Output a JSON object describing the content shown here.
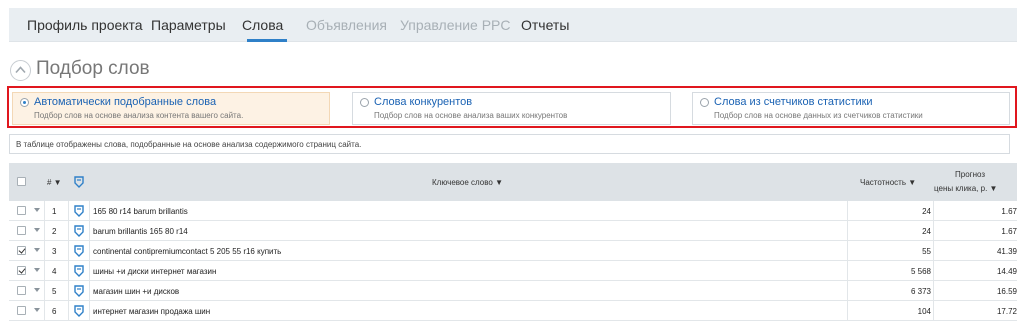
{
  "tabs": [
    {
      "label": "Профиль проекта",
      "state": "normal"
    },
    {
      "label": "Параметры",
      "state": "normal"
    },
    {
      "label": "Слова",
      "state": "active"
    },
    {
      "label": "Объявления",
      "state": "disabled"
    },
    {
      "label": "Управление PPC",
      "state": "disabled"
    },
    {
      "label": "Отчеты",
      "state": "normal"
    }
  ],
  "page": {
    "title": "Подбор слов"
  },
  "options": [
    {
      "title": "Автоматически подобранные слова",
      "desc": "Подбор слов на основе анализа контента вашего сайта.",
      "selected": true
    },
    {
      "title": "Слова конкурентов",
      "desc": "Подбор слов на основе анализа ваших конкурентов",
      "selected": false
    },
    {
      "title": "Слова из счетчиков статистики",
      "desc": "Подбор слов на основе данных из счетчиков статистики",
      "selected": false
    }
  ],
  "info": "В таблице отображены слова, подобранные на основе анализа содержимого страниц сайта.",
  "table": {
    "headers": {
      "num": "#",
      "keyword": "Ключевое слово",
      "frequency": "Частотность",
      "forecast_line1": "Прогноз",
      "forecast_line2": "цены клика, р."
    },
    "rows": [
      {
        "num": "1",
        "keyword": "165 80 r14 barum brillantis",
        "frequency": "24",
        "price": "1.67",
        "checked": false
      },
      {
        "num": "2",
        "keyword": "barum brillantis 165 80 r14",
        "frequency": "24",
        "price": "1.67",
        "checked": false
      },
      {
        "num": "3",
        "keyword": "continental contipremiumcontact 5 205 55 r16 купить",
        "frequency": "55",
        "price": "41.39",
        "checked": true
      },
      {
        "num": "4",
        "keyword": "шины +и диски интернет магазин",
        "frequency": "5 568",
        "price": "14.49",
        "checked": true
      },
      {
        "num": "5",
        "keyword": "магазин шин +и дисков",
        "frequency": "6 373",
        "price": "16.59",
        "checked": false
      },
      {
        "num": "6",
        "keyword": "интернет магазин продажа шин",
        "frequency": "104",
        "price": "17.72",
        "checked": false
      }
    ]
  },
  "colors": {
    "accent": "#2f80c8",
    "highlight": "#e0171e",
    "active_option_bg": "#fdf2e4"
  }
}
